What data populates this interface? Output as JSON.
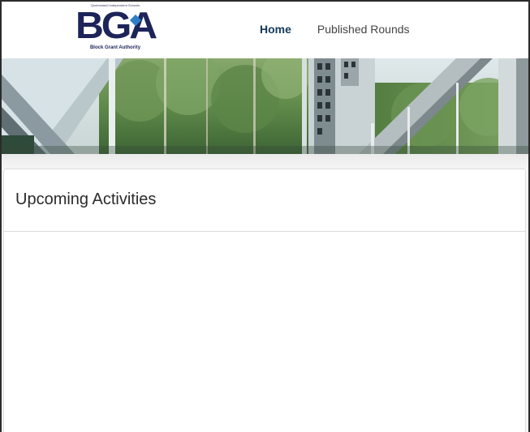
{
  "logo": {
    "letters": "BGA",
    "tagline_top": "Queensland Independent Schools",
    "tagline": "Block Grant Authority"
  },
  "nav": {
    "items": [
      {
        "label": "Home",
        "active": true
      },
      {
        "label": "Published Rounds",
        "active": false
      }
    ]
  },
  "banner": {
    "image": "forest-building-photo"
  },
  "upcoming": {
    "title": "Upcoming Activities"
  },
  "colors": {
    "brand_navy": "#1d2459",
    "nav_active": "#143a5a",
    "accent_blue": "#2f7fc7"
  }
}
